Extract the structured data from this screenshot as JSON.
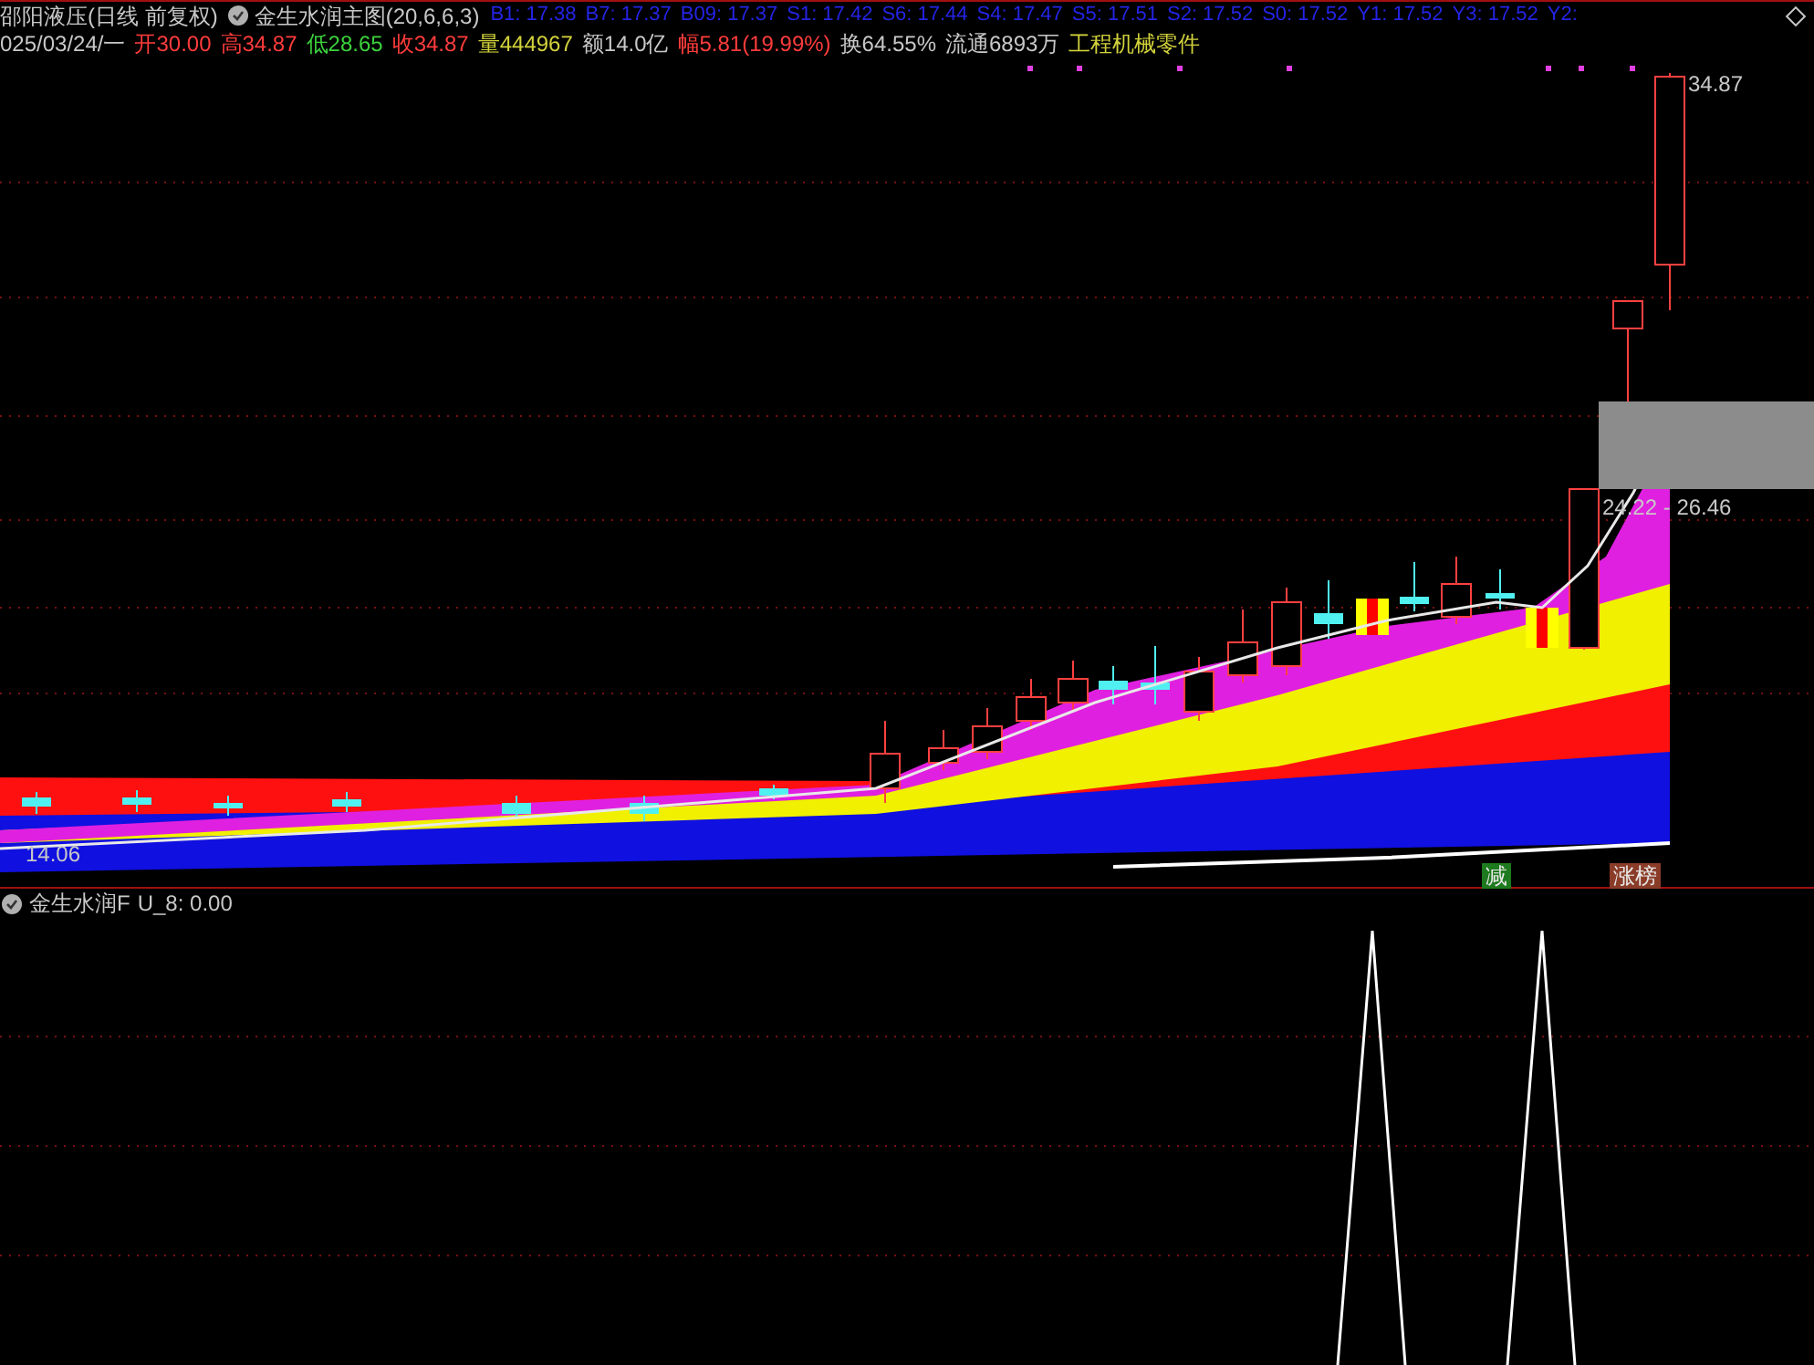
{
  "window": {
    "title": "邵阳液压(日线 前复权)"
  },
  "main_indicator": {
    "name": "金生水润主图(20,6,6,3)",
    "values": [
      "B1: 17.38",
      "B7: 17.37",
      "B09: 17.37",
      "S1: 17.42",
      "S6: 17.44",
      "S4: 17.47",
      "S5: 17.51",
      "S2: 17.52",
      "S0: 17.52",
      "Y1: 17.52",
      "Y3: 17.52",
      "Y2:"
    ]
  },
  "quote": {
    "date": "025/03/24/一",
    "fields": [
      {
        "label": "开",
        "value": "30.00",
        "color": "#ff3c3c"
      },
      {
        "label": "高",
        "value": "34.87",
        "color": "#ff3c3c"
      },
      {
        "label": "低",
        "value": "28.65",
        "color": "#3cd23c"
      },
      {
        "label": "收",
        "value": "34.87",
        "color": "#ff3c3c"
      },
      {
        "label": "量",
        "value": "444967",
        "color": "#d2d23c"
      },
      {
        "label": "额",
        "value": "14.0亿",
        "color": "#c8c8c8"
      },
      {
        "label": "幅",
        "value": "5.81(19.99%)",
        "color": "#ff3c3c"
      },
      {
        "label": "换",
        "value": "64.55%",
        "color": "#c8c8c8"
      },
      {
        "label": "流通",
        "value": "6893万",
        "color": "#c8c8c8"
      }
    ],
    "industry": "工程机械零件"
  },
  "chart_labels": {
    "high": "34.87",
    "range": "24.22 - 26.46",
    "low": "14.06"
  },
  "signals": [
    {
      "label": "减",
      "color": "#1e7a1e"
    },
    {
      "label": "涨榜",
      "color": "#8a3c28"
    }
  ],
  "sub_indicator": {
    "name": "金生水润F",
    "value": "U_8: 0.00"
  }
}
